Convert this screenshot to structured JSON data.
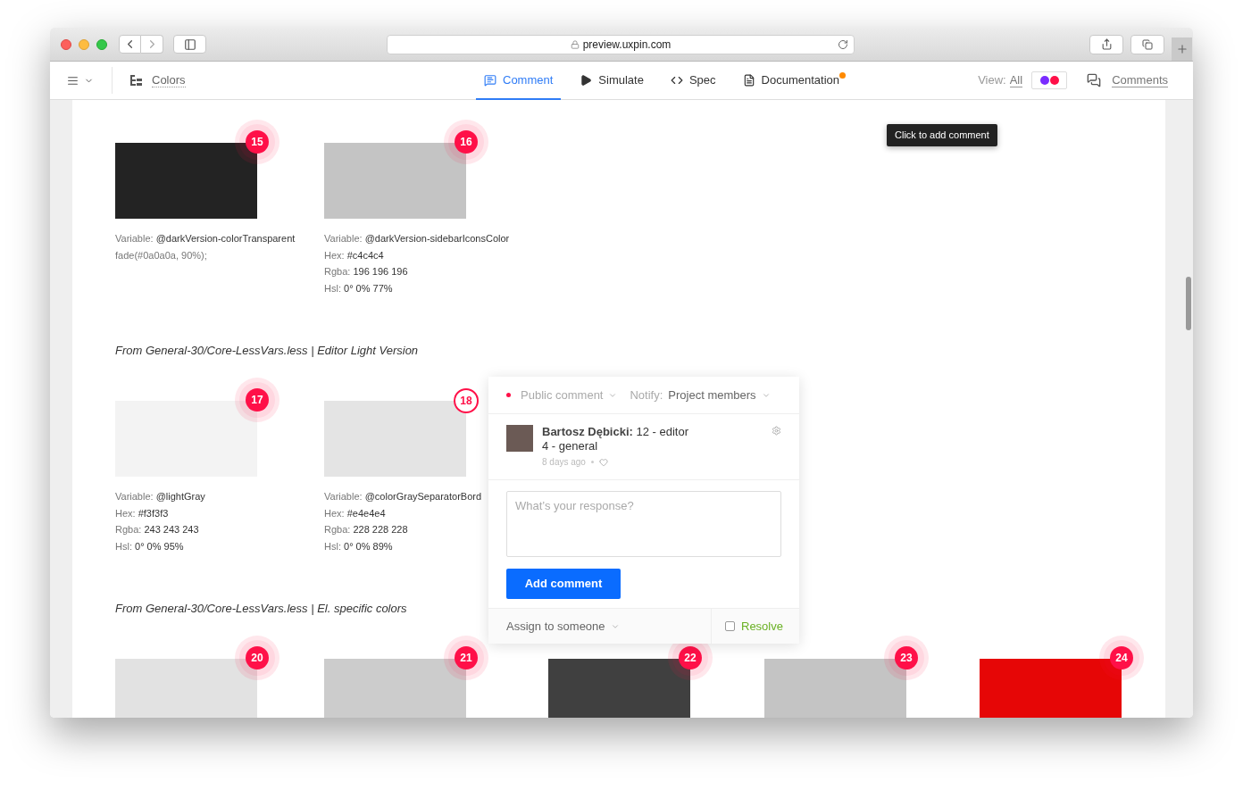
{
  "browser": {
    "url": "preview.uxpin.com"
  },
  "toolbar": {
    "page": "Colors",
    "tabs": [
      {
        "label": "Comment",
        "kind": "comment",
        "selected": true,
        "notification": false
      },
      {
        "label": "Simulate",
        "kind": "simulate",
        "selected": false,
        "notification": false
      },
      {
        "label": "Spec",
        "kind": "spec",
        "selected": false,
        "notification": false
      },
      {
        "label": "Documentation",
        "kind": "documentation",
        "selected": false,
        "notification": true
      }
    ],
    "colors_toggle_on": true,
    "view_label": "View:",
    "view_value": "All",
    "comments_link": "Comments"
  },
  "tooltip": "Click to add comment",
  "sections": [
    {
      "swatches": [
        {
          "badge": "15",
          "color": "#232323",
          "selected": false,
          "lines": [
            {
              "label": "Variable:",
              "value": "@darkVersion-colorTransparent"
            },
            {
              "label": "fade(#0a0a0a, 90%);"
            }
          ]
        },
        {
          "badge": "16",
          "color": "#c4c4c4",
          "selected": false,
          "lines": [
            {
              "label": "Variable:",
              "value": "@darkVersion-sidebarIconsColor"
            },
            {
              "label": "Hex:",
              "value": "#c4c4c4"
            },
            {
              "label": "Rgba:",
              "value": "196 196 196"
            },
            {
              "label": "Hsl:",
              "value": "0° 0% 77%"
            }
          ]
        }
      ]
    },
    {
      "heading": "From General-30/Core-LessVars.less | Editor Light Version",
      "swatches": [
        {
          "badge": "17",
          "color": "#f3f3f3",
          "selected": false,
          "lines": [
            {
              "label": "Variable:",
              "value": "@lightGray"
            },
            {
              "label": "Hex:",
              "value": "#f3f3f3"
            },
            {
              "label": "Rgba:",
              "value": "243 243 243"
            },
            {
              "label": "Hsl:",
              "value": "0° 0% 95%"
            }
          ]
        },
        {
          "badge": "18",
          "color": "#e4e4e4",
          "selected": true,
          "lines": [
            {
              "label": "Variable:",
              "value": "@colorGraySeparatorBord"
            },
            {
              "label": "Hex:",
              "value": "#e4e4e4"
            },
            {
              "label": "Rgba:",
              "value": "228 228 228"
            },
            {
              "label": "Hsl:",
              "value": "0° 0% 89%"
            }
          ]
        }
      ]
    },
    {
      "heading": "From General-30/Core-LessVars.less | El. specific colors",
      "swatches": [
        {
          "badge": "20",
          "color": "#e2e2e2",
          "selected": false
        },
        {
          "badge": "21",
          "color": "#cccccc",
          "selected": false
        },
        {
          "badge": "22",
          "color": "#404040",
          "selected": false
        },
        {
          "badge": "23",
          "color": "#c4c4c4",
          "selected": false
        },
        {
          "badge": "24",
          "color": "#e60606",
          "selected": false
        }
      ]
    }
  ],
  "comment_popup": {
    "visibility": "Public comment",
    "notify_label": "Notify:",
    "notify_value": "Project members",
    "author": "Bartosz Dębicki:",
    "body_lines": [
      "12 - editor",
      "4 - general"
    ],
    "time": "8 days ago",
    "response_placeholder": "What’s your response?",
    "submit": "Add comment",
    "assign": "Assign to someone",
    "resolve": {
      "label": "Resolve",
      "checked": false
    }
  }
}
